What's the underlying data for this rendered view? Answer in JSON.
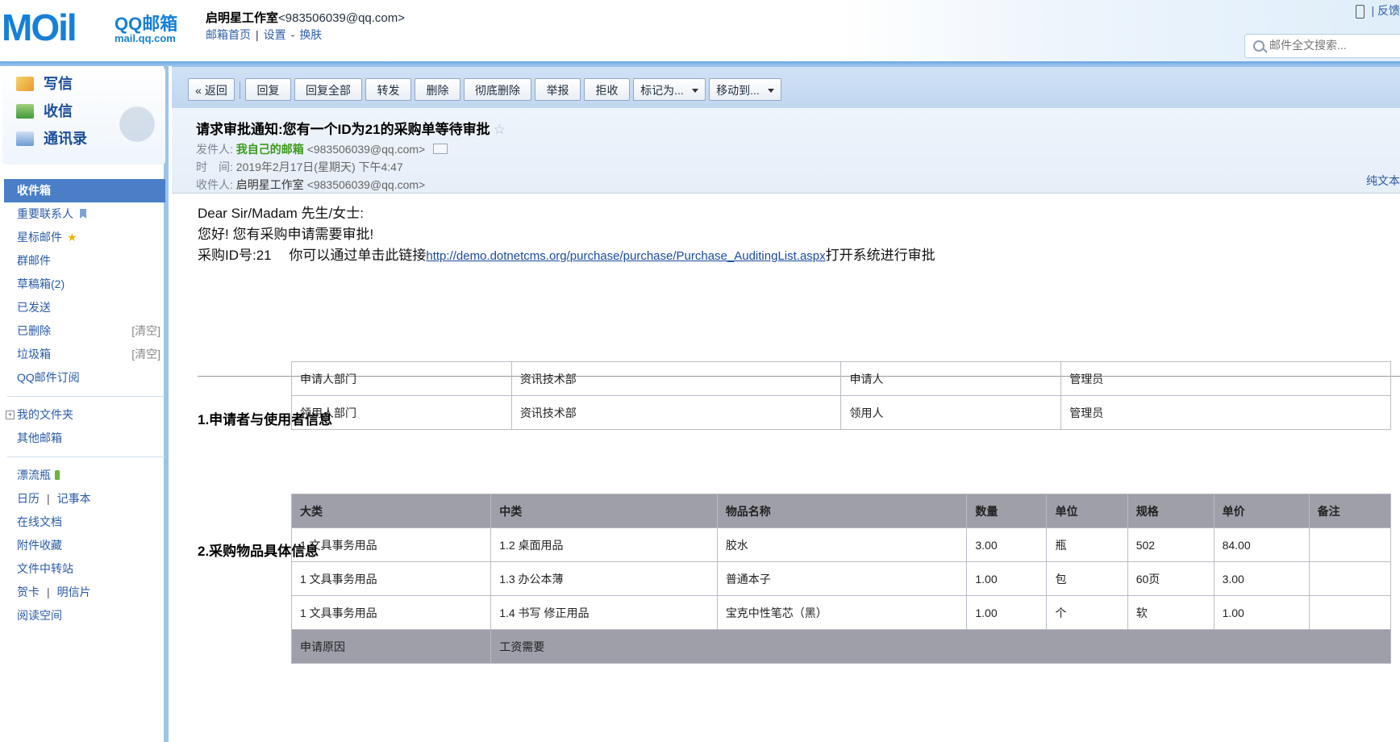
{
  "header": {
    "logo_text_mail": "MOil",
    "logo_qq": "QQ邮箱",
    "logo_url": "mail.qq.com",
    "user_name": "启明星工作室",
    "user_email": "<983506039@qq.com>",
    "links": [
      "邮箱首页",
      "设置",
      "换肤"
    ],
    "right_links": "| 反馈",
    "search_placeholder": "邮件全文搜索..."
  },
  "sidebar": {
    "quick": [
      "写信",
      "收信",
      "通讯录"
    ],
    "nav": [
      "收件箱",
      "重要联系人",
      "星标邮件",
      "群邮件",
      "草稿箱(2)",
      "已发送",
      "已删除",
      "垃圾箱",
      "QQ邮件订阅"
    ],
    "clear_label": "[清空]",
    "folders": [
      "我的文件夹",
      "其他邮箱"
    ],
    "apps": {
      "bottle": "漂流瓶",
      "calendar": "日历",
      "notebook": "记事本",
      "docs": "在线文档",
      "attachments": "附件收藏",
      "transfer": "文件中转站",
      "card": "贺卡",
      "postcard": "明信片",
      "reading": "阅读空间"
    }
  },
  "toolbar": {
    "back": "« 返回",
    "buttons": [
      "回复",
      "回复全部",
      "转发",
      "删除",
      "彻底删除",
      "举报",
      "拒收"
    ],
    "mark_as": "标记为...",
    "move_to": "移动到..."
  },
  "mail": {
    "subject": "请求审批通知:您有一个ID为21的采购单等待审批",
    "from_label": "发件人:",
    "from_name": "我自己的邮箱",
    "from_email": "<983506039@qq.com>",
    "time_label": "时　间:",
    "time": "2019年2月17日(星期天) 下午4:47",
    "to_label": "收件人:",
    "to_name": "启明星工作室",
    "to_email": "<983506039@qq.com>",
    "plain_text": "纯文本"
  },
  "body": {
    "greeting": "Dear Sir/Madam 先生/女士:",
    "line2": "您好! 您有采购申请需要审批!",
    "line3_prefix": "采购ID号:21　 你可以通过单击此链接",
    "link": "http://demo.dotnetcms.org/purchase/purchase/Purchase_AuditingList.aspx",
    "line3_suffix": "打开系统进行审批"
  },
  "section1": {
    "title": "1.申请者与使用者信息",
    "rows": [
      [
        "申请人部门",
        "资讯技术部",
        "申请人",
        "管理员"
      ],
      [
        "领用人部门",
        "资讯技术部",
        "领用人",
        "管理员"
      ]
    ]
  },
  "section2": {
    "title": "2.采购物品具体信息",
    "headers": [
      "大类",
      "中类",
      "物品名称",
      "数量",
      "单位",
      "规格",
      "单价",
      "备注"
    ],
    "rows": [
      [
        "1 文具事务用品",
        "1.2 桌面用品",
        "胶水",
        "3.00",
        "瓶",
        "502",
        "84.00",
        ""
      ],
      [
        "1 文具事务用品",
        "1.3 办公本薄",
        "普通本子",
        "1.00",
        "包",
        "60页",
        "3.00",
        ""
      ],
      [
        "1 文具事务用品",
        "1.4 书写 修正用品",
        "宝克中性笔芯（黑）",
        "1.00",
        "个",
        "软",
        "1.00",
        ""
      ]
    ],
    "reason_label": "申请原因",
    "reason": "工资需要"
  }
}
